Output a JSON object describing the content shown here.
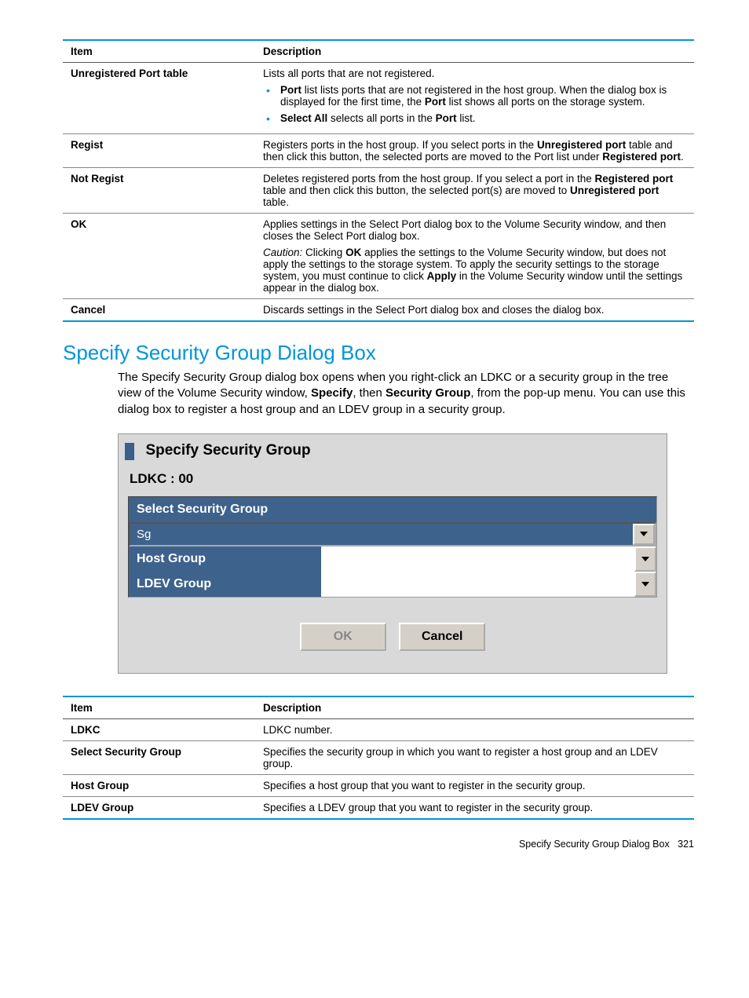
{
  "table1": {
    "head_item": "Item",
    "head_desc": "Description",
    "rows": [
      {
        "item": "Unregistered Port table",
        "paras": [
          {
            "segs": [
              {
                "t": "Lists all ports that are not registered."
              }
            ]
          }
        ],
        "bullets": [
          {
            "segs": [
              {
                "t": "Port",
                "b": true
              },
              {
                "t": " list lists ports that are not registered in the host group. When the dialog box is displayed for the first time, the "
              },
              {
                "t": "Port",
                "b": true
              },
              {
                "t": " list shows all ports on the storage system."
              }
            ]
          },
          {
            "segs": [
              {
                "t": "Select All",
                "b": true
              },
              {
                "t": " selects all ports in the "
              },
              {
                "t": "Port",
                "b": true
              },
              {
                "t": " list."
              }
            ]
          }
        ]
      },
      {
        "item": "Regist",
        "paras": [
          {
            "segs": [
              {
                "t": "Registers ports in the host group. If you select ports in the "
              },
              {
                "t": "Unregistered port",
                "b": true
              },
              {
                "t": " table and then click this button, the selected ports are moved to the Port list under "
              },
              {
                "t": "Registered port",
                "b": true
              },
              {
                "t": "."
              }
            ]
          }
        ]
      },
      {
        "item": "Not Regist",
        "paras": [
          {
            "segs": [
              {
                "t": "Deletes registered ports from the host group. If you select a port in the "
              },
              {
                "t": "Registered port",
                "b": true
              },
              {
                "t": " table and then click this button, the selected port(s) are moved to "
              },
              {
                "t": "Unregistered port",
                "b": true
              },
              {
                "t": " table."
              }
            ]
          }
        ]
      },
      {
        "item": "OK",
        "paras": [
          {
            "segs": [
              {
                "t": "Applies settings in the Select Port dialog box to the Volume Security window, and then closes the Select Port dialog box."
              }
            ]
          },
          {
            "segs": [
              {
                "t": "Caution:",
                "i": true
              },
              {
                "t": " Clicking "
              },
              {
                "t": "OK",
                "b": true
              },
              {
                "t": " applies the settings to the Volume Security window, but does not apply the settings to the storage system. To apply the security settings to the storage system, you must continue to click "
              },
              {
                "t": "Apply",
                "b": true
              },
              {
                "t": " in the Volume Security window until the settings appear in the dialog box."
              }
            ]
          }
        ]
      },
      {
        "item": "Cancel",
        "paras": [
          {
            "segs": [
              {
                "t": "Discards settings in the Select Port dialog box and closes the dialog box."
              }
            ]
          }
        ]
      }
    ]
  },
  "section": {
    "title": "Specify Security Group Dialog Box",
    "body_segs": [
      {
        "t": "The Specify Security Group dialog box opens when you right-click an LDKC or a security group in the tree view of the Volume Security window, "
      },
      {
        "t": "Specify",
        "b": true
      },
      {
        "t": ", then "
      },
      {
        "t": "Security Group",
        "b": true
      },
      {
        "t": ", from the pop-up menu. You can use this dialog box to register a host group and an LDEV group in a security group."
      }
    ]
  },
  "dialog": {
    "title": "Specify Security Group",
    "ldkc": "LDKC : 00",
    "select_label": "Select Security Group",
    "combo_value": "Sg",
    "host_group_label": "Host Group",
    "host_group_value": "",
    "ldev_group_label": "LDEV Group",
    "ldev_group_value": "",
    "ok": "OK",
    "cancel": "Cancel"
  },
  "table2": {
    "head_item": "Item",
    "head_desc": "Description",
    "rows": [
      {
        "item": "LDKC",
        "paras": [
          {
            "segs": [
              {
                "t": "LDKC number."
              }
            ]
          }
        ]
      },
      {
        "item": "Select Security Group",
        "paras": [
          {
            "segs": [
              {
                "t": "Specifies the security group in which you want to register a host group and an LDEV group."
              }
            ]
          }
        ]
      },
      {
        "item": "Host Group",
        "paras": [
          {
            "segs": [
              {
                "t": "Specifies a host group that you want to register in the security group."
              }
            ]
          }
        ]
      },
      {
        "item": "LDEV Group",
        "paras": [
          {
            "segs": [
              {
                "t": "Specifies a LDEV group that you want to register in the security group."
              }
            ]
          }
        ]
      }
    ]
  },
  "footer": {
    "label": "Specify Security Group Dialog Box",
    "page": "321"
  }
}
